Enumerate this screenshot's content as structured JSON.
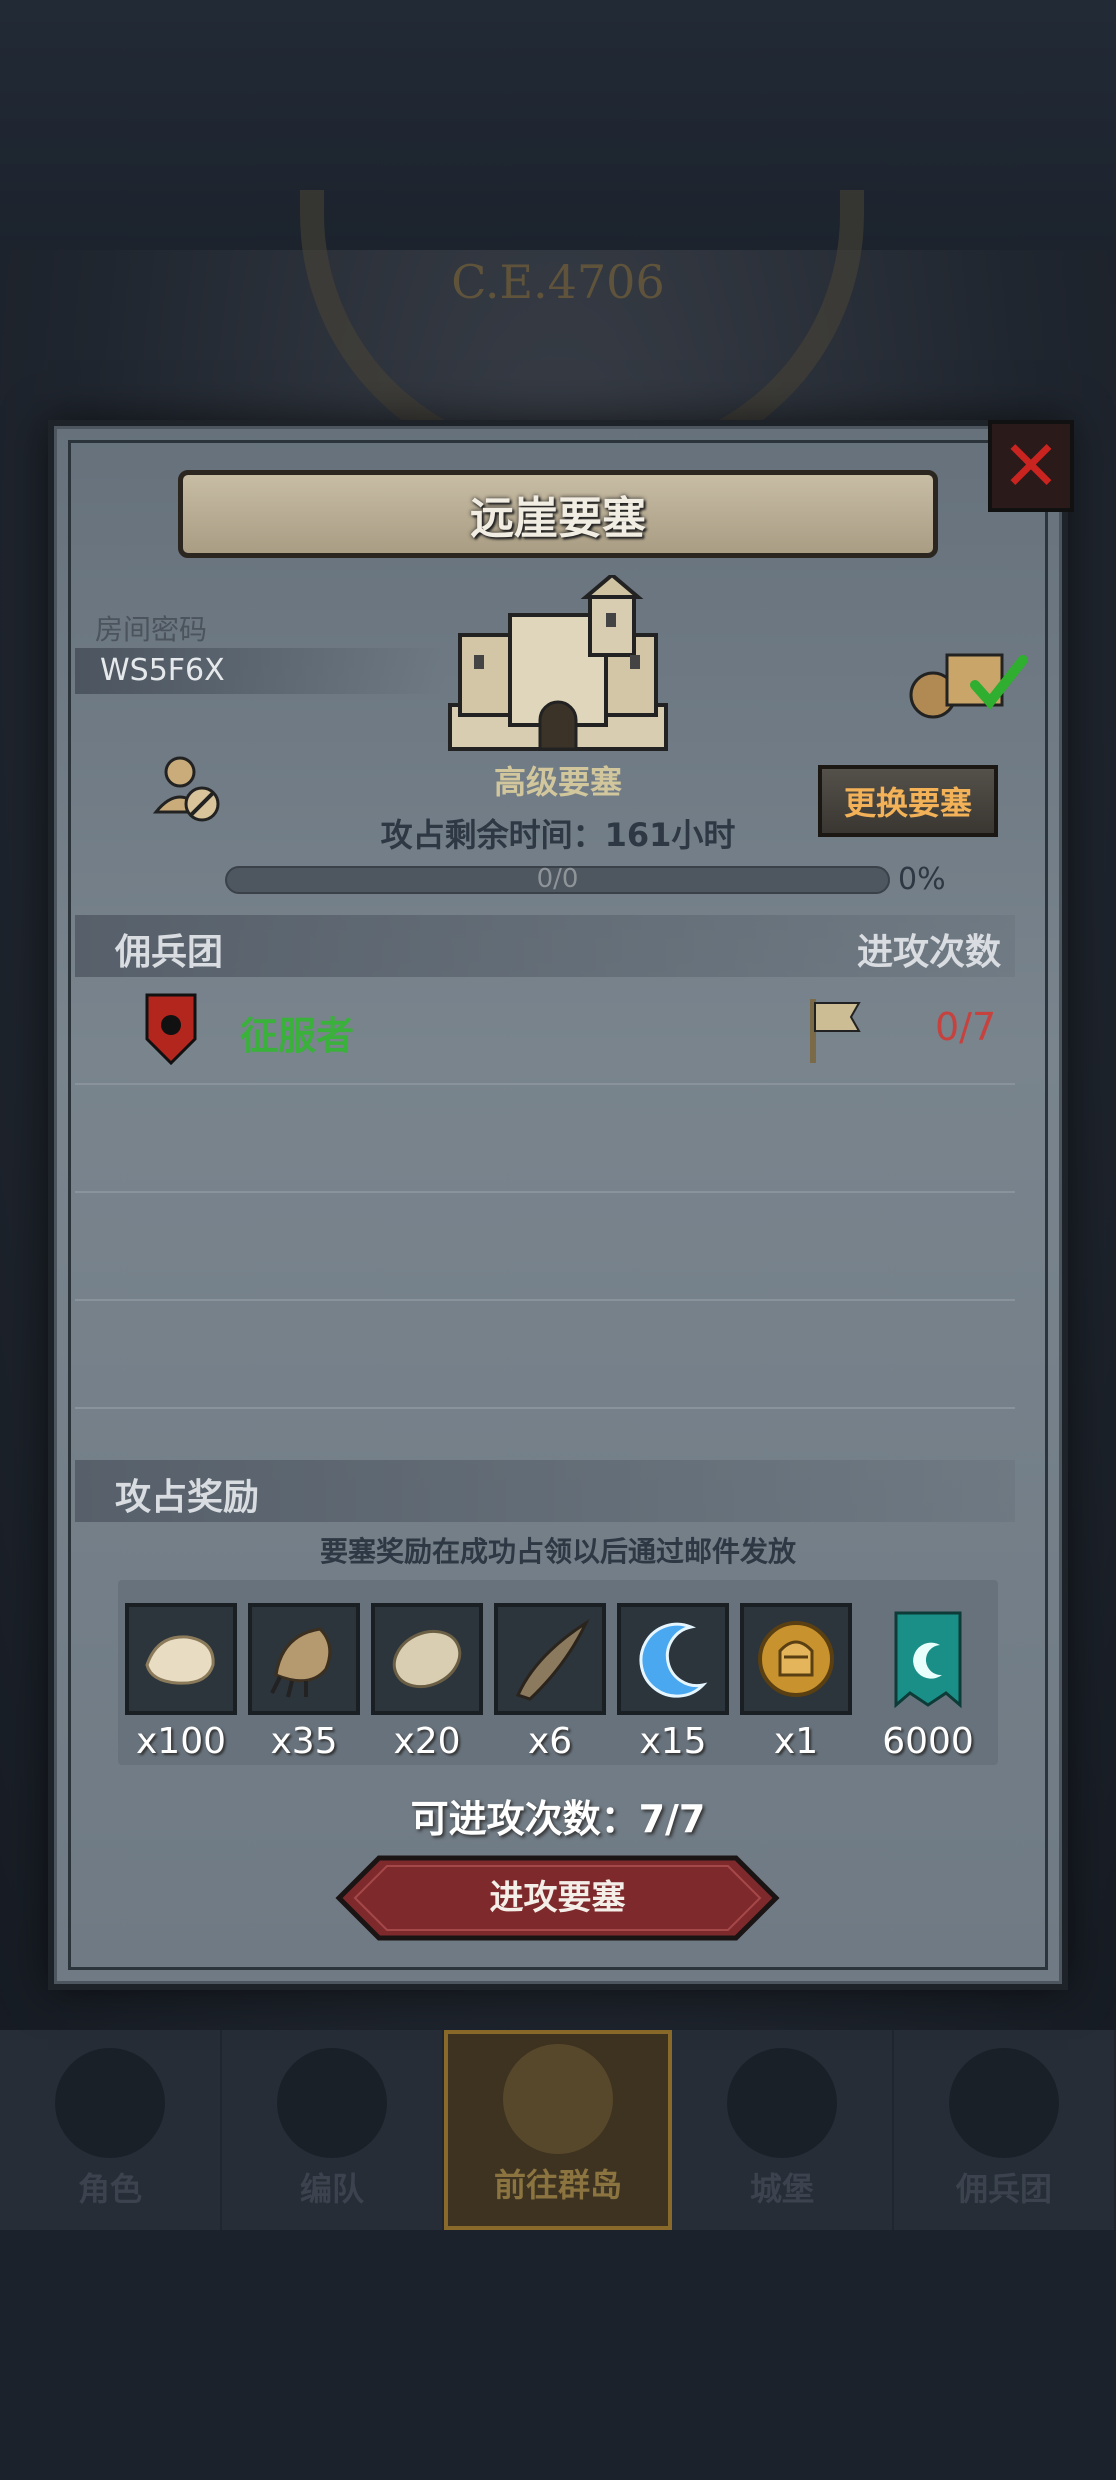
{
  "background": {
    "era": "C.E.4706"
  },
  "modal": {
    "title": "远崖要塞",
    "close_icon": "close-icon",
    "room_code_label": "房间密码",
    "room_code_value": "WS5F6X",
    "fortress_grade": "高级要塞",
    "change_button": "更换要塞",
    "remaining_time": "攻占剩余时间：161小时",
    "progress": {
      "text": "0/0",
      "percent": "0%",
      "value": 0
    },
    "mercenary_header": "佣兵团",
    "attack_count_header": "进攻次数",
    "mercenaries": [
      {
        "name": "征服者",
        "attacks": "0/7"
      }
    ],
    "reward_header": "攻占奖励",
    "reward_note": "要塞奖励在成功占领以后通过邮件发放",
    "rewards": [
      {
        "icon": "fur-pelt-icon",
        "qty": "x100"
      },
      {
        "icon": "beast-claw-icon",
        "qty": "x35"
      },
      {
        "icon": "scale-hide-icon",
        "qty": "x20"
      },
      {
        "icon": "horn-icon",
        "qty": "x6"
      },
      {
        "icon": "blue-crescent-icon",
        "qty": "x15"
      },
      {
        "icon": "knight-medal-icon",
        "qty": "x1"
      },
      {
        "icon": "guild-banner-icon",
        "qty": "6000"
      }
    ],
    "attack_remaining": "可进攻次数：7/7",
    "attack_button": "进攻要塞"
  },
  "bottom_nav": [
    {
      "label": "角色",
      "icon": "knight-icon"
    },
    {
      "label": "编队",
      "icon": "helmet-icon"
    },
    {
      "label": "前往群岛",
      "icon": "compass-icon",
      "active": true
    },
    {
      "label": "城堡",
      "icon": "castle-icon"
    },
    {
      "label": "佣兵团",
      "icon": "mercenary-icon"
    }
  ],
  "colors": {
    "accent_orange": "#f3b258",
    "merc_green": "#39b13a",
    "count_red": "#c6423f",
    "close_red": "#c9241f"
  }
}
